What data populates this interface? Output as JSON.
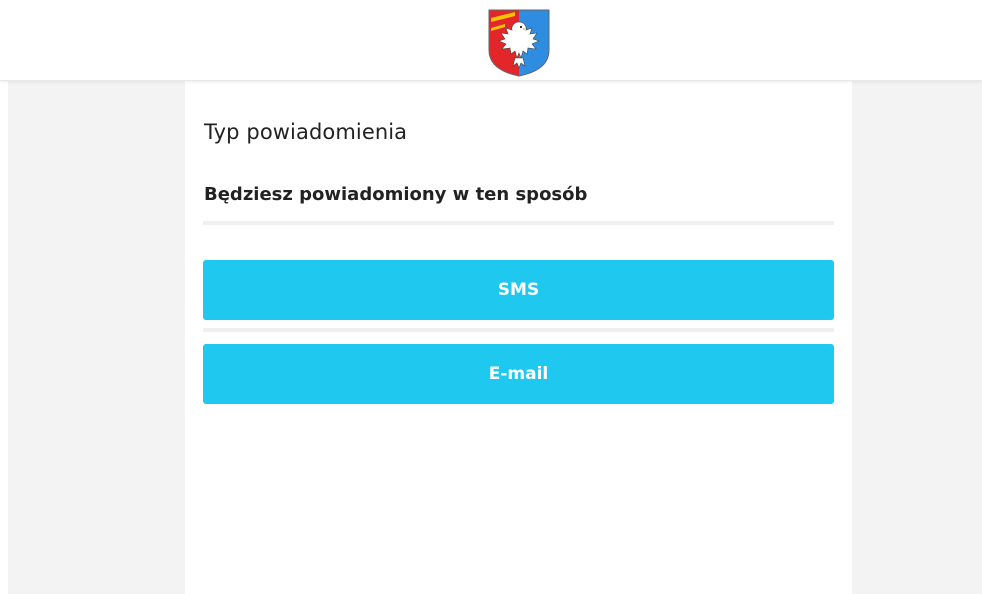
{
  "header": {
    "logo_icon": "coat-of-arms-eagle-icon"
  },
  "page": {
    "title": "Typ powiadomienia",
    "subtitle": "Będziesz powiadomiony w ten sposób"
  },
  "options": [
    {
      "label": "SMS"
    },
    {
      "label": "E-mail"
    }
  ],
  "colors": {
    "button_background": "#1fc8ef",
    "button_text": "#ffffff",
    "page_background": "#f3f3f3",
    "card_background": "#ffffff",
    "coat_of_arms_red": "#e3262a",
    "coat_of_arms_blue": "#2e8de0"
  }
}
